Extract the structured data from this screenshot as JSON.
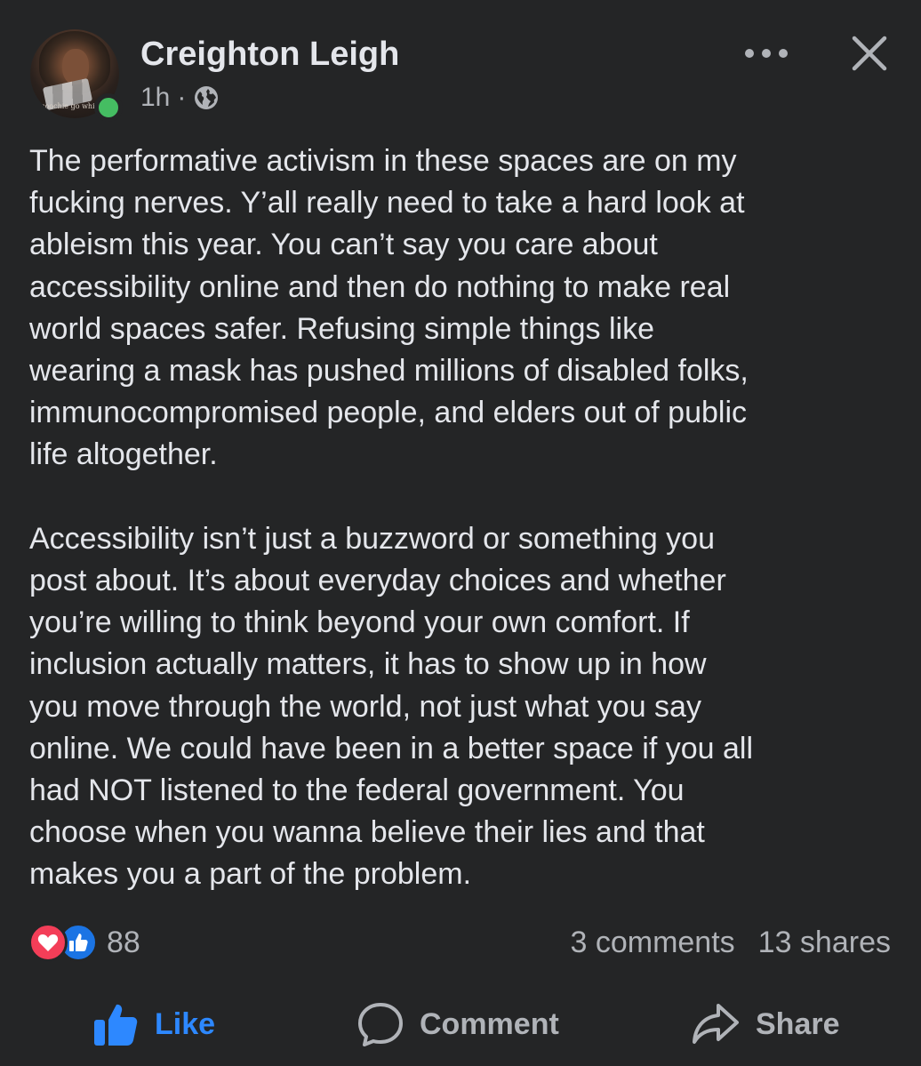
{
  "post": {
    "author": {
      "name": "Creighton Leigh",
      "avatar_caption": "coochie go whi"
    },
    "meta": {
      "time": "1h",
      "separator": "·",
      "audience_icon": "globe-icon"
    },
    "header_icons": {
      "more": "more-options-icon",
      "close": "close-icon"
    },
    "body": {
      "paragraph1": [
        "The performative activism in these spaces are on my",
        "fucking nerves. Y’all really need to take a hard look at",
        "ableism this year. You can’t say you care about",
        "accessibility online and then do nothing to make real",
        "world spaces safer. Refusing simple things like",
        "wearing a mask has pushed millions of disabled folks,",
        "immunocompromised people, and elders out of public",
        "life altogether."
      ],
      "paragraph2": [
        "Accessibility isn’t just a buzzword or something you",
        "post about. It’s about everyday choices and whether",
        "you’re willing to think beyond your own comfort. If",
        "inclusion actually matters, it has to show up in how",
        "you move through the world, not just what you say",
        "online. We could have been in a better space if you all",
        "had NOT listened to the federal government. You",
        "choose when you wanna believe their lies and that",
        "makes you a part of the problem."
      ]
    },
    "stats": {
      "reaction_icons": [
        "love-icon",
        "like-icon"
      ],
      "reaction_count": "88",
      "comments": "3 comments",
      "shares": "13 shares"
    },
    "actions": {
      "like_label": "Like",
      "comment_label": "Comment",
      "share_label": "Share"
    },
    "colors": {
      "background": "#242526",
      "text": "#e4e6eb",
      "secondary_text": "#b0b3b8",
      "like_blue": "#2d88ff",
      "love_red": "#f33e58",
      "online_green": "#45bd62"
    }
  }
}
